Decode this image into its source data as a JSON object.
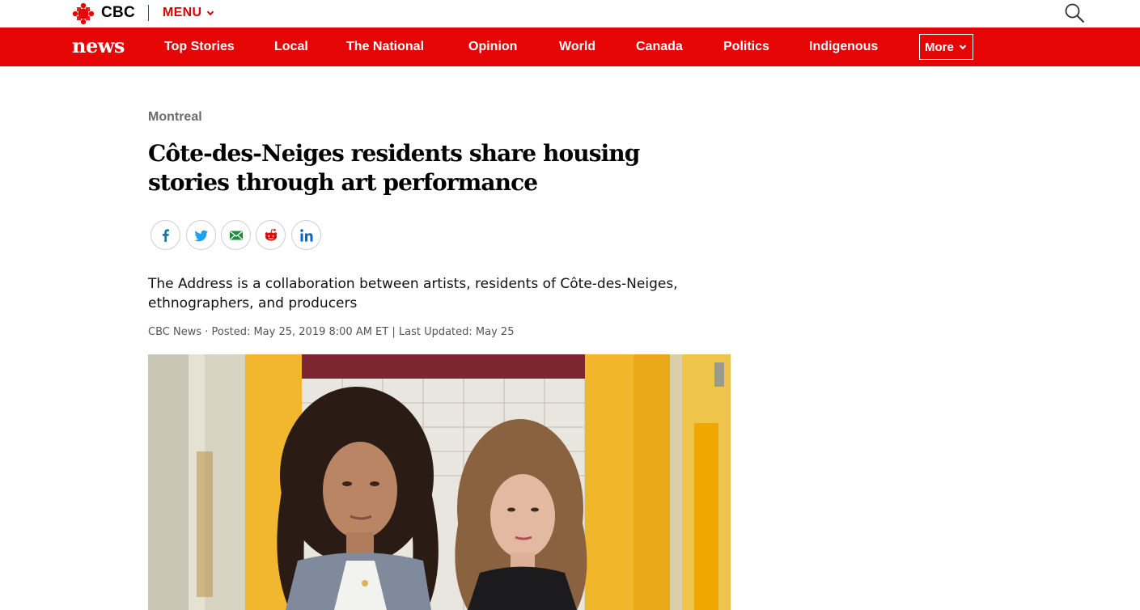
{
  "header": {
    "brand": "CBC",
    "menu_label": "MENU",
    "colors": {
      "brand_red": "#e60505",
      "text_grey": "#6b6b6b"
    }
  },
  "nav": {
    "logo": "news",
    "items": [
      "Top Stories",
      "Local",
      "The National",
      "Opinion",
      "World",
      "Canada",
      "Politics",
      "Indigenous"
    ],
    "more_label": "More"
  },
  "article": {
    "section": "Montreal",
    "headline": "Côte-des-Neiges residents share housing stories through art performance",
    "share_icons": [
      "facebook-icon",
      "twitter-icon",
      "email-icon",
      "reddit-icon",
      "linkedin-icon"
    ],
    "deck": "The Address is a collaboration between artists, residents of Côte-des-Neiges, ethnographers, and producers",
    "byline": "CBC News · Posted: May 25, 2019 8:00 AM ET | Last Updated: May 25"
  }
}
